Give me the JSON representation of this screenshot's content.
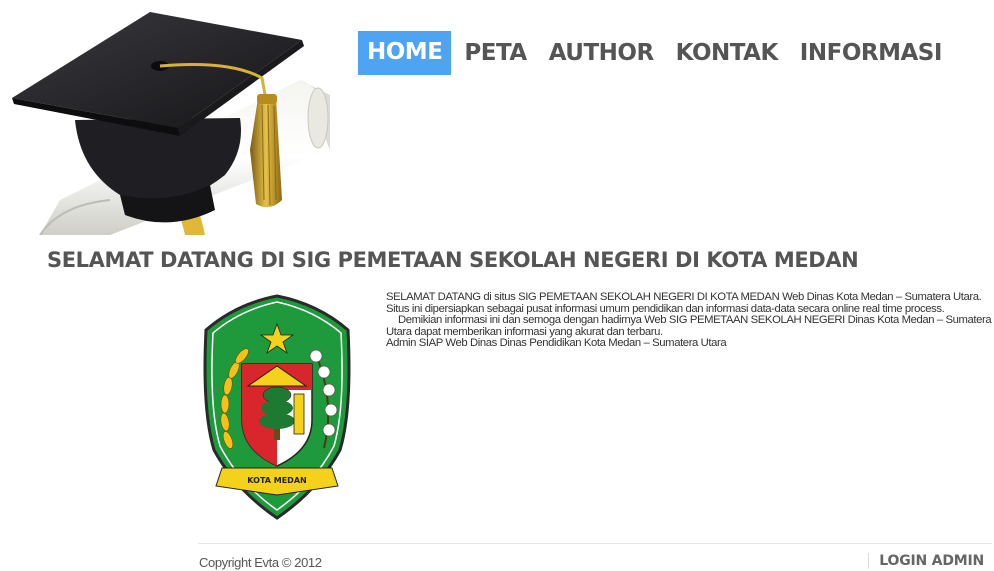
{
  "nav": {
    "items": [
      {
        "label": "HOME",
        "active": true
      },
      {
        "label": "PETA",
        "active": false
      },
      {
        "label": "AUTHOR",
        "active": false
      },
      {
        "label": "KONTAK",
        "active": false
      },
      {
        "label": "INFORMASI",
        "active": false
      }
    ],
    "active_color": "#4ea3f2"
  },
  "main": {
    "title": "SELAMAT DATANG DI SIG PEMETAAN SEKOLAH NEGERI DI KOTA MEDAN",
    "paragraph1": "SELAMAT DATANG di situs SIG PEMETAAN SEKOLAH NEGERI DI KOTA MEDAN Web Dinas Kota Medan – Sumatera Utara. Situs ini dipersiapkan sebagai pusat informasi umum pendidikan dan informasi data-data secara online real time process.",
    "paragraph2": "Demikian informasi ini dan semoga dengan hadirnya Web SIG PEMETAAN SEKOLAH NEGERI Dinas Kota Medan – Sumatera Utara dapat memberikan informasi yang akurat dan terbaru.",
    "paragraph3": "Admin SIAP Web Dinas Dinas Pendidikan Kota Medan – Sumatera Utara",
    "emblem_ribbon_text": "KOTA MEDAN"
  },
  "footer": {
    "copyright": "Copyright Evta © 2012",
    "login_label": "LOGIN ADMIN"
  },
  "images": {
    "hero": "graduation-cap-and-diploma",
    "emblem": "kota-medan-coat-of-arms"
  }
}
